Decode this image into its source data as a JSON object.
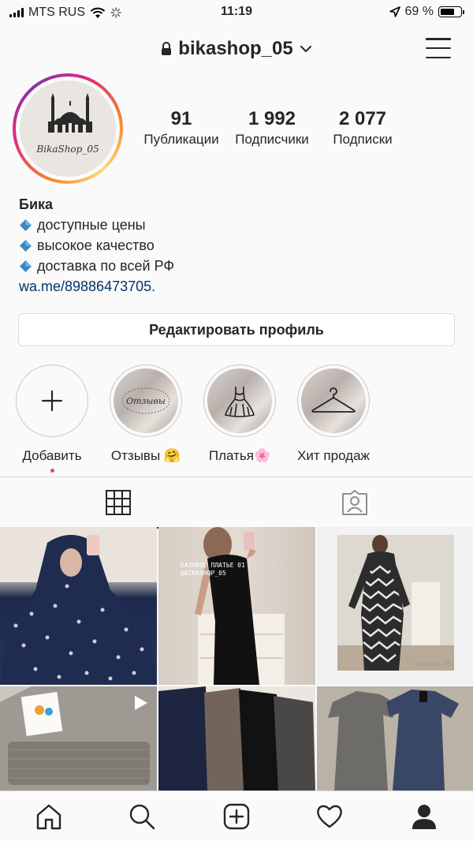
{
  "status_bar": {
    "carrier": "MTS RUS",
    "time": "11:19",
    "battery_percent": "69 %",
    "battery_level": 0.69
  },
  "header": {
    "username": "bikashop_05",
    "lock_icon": "lock-icon",
    "dropdown_icon": "chevron-down-icon",
    "menu_icon": "hamburger-menu-icon"
  },
  "profile": {
    "avatar_text": "BikaShop_05",
    "stats": [
      {
        "value": "91",
        "label": "Публикации"
      },
      {
        "value": "1 992",
        "label": "Подписчики"
      },
      {
        "value": "2 077",
        "label": "Подписки"
      }
    ],
    "name": "Бика",
    "bio_lines": [
      "доступные цены",
      "высокое качество",
      "доставка по всей РФ"
    ],
    "link": "wa.me/89886473705."
  },
  "edit_profile_label": "Редактировать профиль",
  "highlights": [
    {
      "label": "Добавить",
      "icon": "plus-icon"
    },
    {
      "label": "Отзывы 🤗",
      "icon": "reviews-script-icon",
      "cover_text": "Отзывы"
    },
    {
      "label": "Платья🌸",
      "icon": "dress-icon"
    },
    {
      "label": "Хит продаж",
      "icon": "hanger-icon"
    }
  ],
  "tabs": [
    {
      "name": "grid",
      "icon": "grid-icon",
      "active": true
    },
    {
      "name": "tagged",
      "icon": "tagged-person-icon",
      "active": false
    }
  ],
  "posts": [
    {
      "overlay_text": ""
    },
    {
      "overlay_text": "БАЗОВОЕ ПЛАТЬЕ 01\n@BIKASHOP_05"
    },
    {
      "overlay_text": "bikashop_05"
    },
    {
      "overlay_text": "",
      "is_video": true
    },
    {
      "overlay_text": ""
    },
    {
      "overlay_text": ""
    }
  ],
  "bottom_nav": [
    {
      "name": "home",
      "icon": "home-icon"
    },
    {
      "name": "search",
      "icon": "search-icon"
    },
    {
      "name": "new-post",
      "icon": "add-post-icon"
    },
    {
      "name": "activity",
      "icon": "heart-icon"
    },
    {
      "name": "profile",
      "icon": "profile-icon",
      "active": true
    }
  ],
  "colors": {
    "link": "#003569",
    "text": "#262626",
    "border": "#dbdbdb",
    "notification_dot": "#ed4956"
  }
}
